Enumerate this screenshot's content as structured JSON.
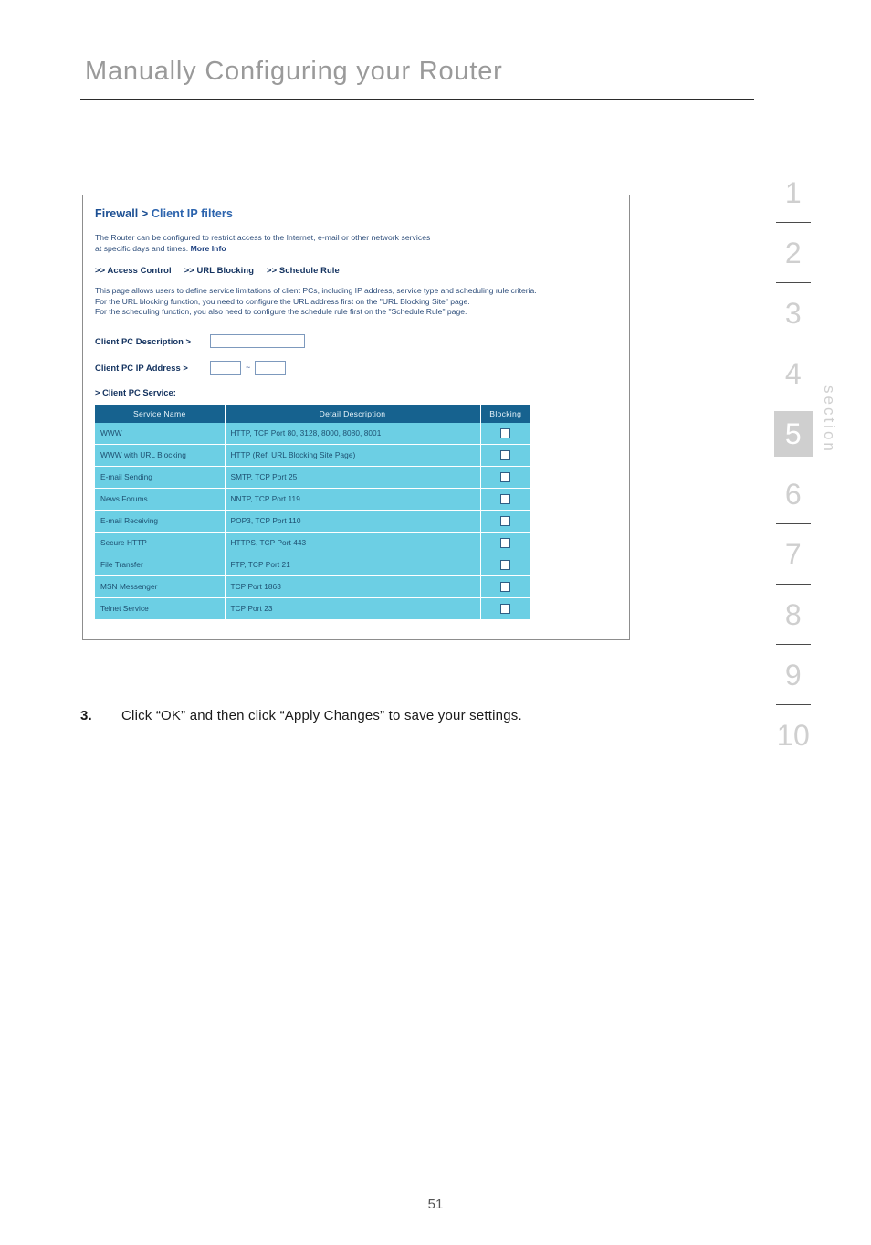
{
  "page": {
    "title": "Manually Configuring your Router",
    "number": "51"
  },
  "section_rail": {
    "label": "section",
    "items": [
      {
        "number": "1",
        "active": false
      },
      {
        "number": "2",
        "active": false
      },
      {
        "number": "3",
        "active": false
      },
      {
        "number": "4",
        "active": false
      },
      {
        "number": "5",
        "active": true
      },
      {
        "number": "6",
        "active": false
      },
      {
        "number": "7",
        "active": false
      },
      {
        "number": "8",
        "active": false
      },
      {
        "number": "9",
        "active": false
      },
      {
        "number": "10",
        "active": false
      }
    ]
  },
  "router_ui": {
    "breadcrumb_primary": "Firewall",
    "breadcrumb_separator": " > ",
    "breadcrumb_secondary": "Client IP filters",
    "intro_line1": "The Router can be configured to restrict access to the Internet, e-mail or other network services",
    "intro_line2": "at specific days and times. ",
    "more_info_link": "More Info",
    "nav_links": [
      ">> Access Control",
      ">> URL Blocking",
      ">> Schedule Rule"
    ],
    "description_line1": "This page allows users to define service limitations of client PCs, including IP address, service type and scheduling rule criteria.",
    "description_line2": "For the URL blocking function, you need to configure the URL address first on the \"URL Blocking Site\" page.",
    "description_line3": "For the scheduling function, you also need to configure the schedule rule first on the \"Schedule Rule\" page.",
    "fields": {
      "description_label": "Client PC Description >",
      "description_value": "",
      "ip_label": "Client PC IP Address >",
      "ip_start_value": "",
      "ip_end_value": "",
      "ip_range_separator": "~"
    },
    "service_section_label": "> Client PC Service:",
    "table": {
      "headers": [
        "Service Name",
        "Detail Description",
        "Blocking"
      ],
      "rows": [
        {
          "name": "WWW",
          "detail": "HTTP, TCP Port 80, 3128, 8000, 8080, 8001",
          "blocking": false
        },
        {
          "name": "WWW with URL Blocking",
          "detail": "HTTP (Ref. URL Blocking Site Page)",
          "blocking": false
        },
        {
          "name": "E-mail Sending",
          "detail": "SMTP, TCP Port 25",
          "blocking": false
        },
        {
          "name": "News Forums",
          "detail": "NNTP, TCP Port 119",
          "blocking": false
        },
        {
          "name": "E-mail Receiving",
          "detail": "POP3, TCP Port 110",
          "blocking": false
        },
        {
          "name": "Secure HTTP",
          "detail": "HTTPS, TCP Port 443",
          "blocking": false
        },
        {
          "name": "File Transfer",
          "detail": "FTP, TCP Port 21",
          "blocking": false
        },
        {
          "name": "MSN Messenger",
          "detail": "TCP Port 1863",
          "blocking": false
        },
        {
          "name": "Telnet Service",
          "detail": "TCP Port 23",
          "blocking": false
        }
      ]
    }
  },
  "step": {
    "number": "3.",
    "text": "Click “OK” and then click “Apply Changes” to save your settings."
  },
  "colors": {
    "title_gray": "#9a9a9a",
    "ui_blue": "#1c4f93",
    "table_header_blue": "#16628f",
    "table_row_cyan": "#6ccfe4",
    "rail_gray": "#cfcfcf"
  }
}
